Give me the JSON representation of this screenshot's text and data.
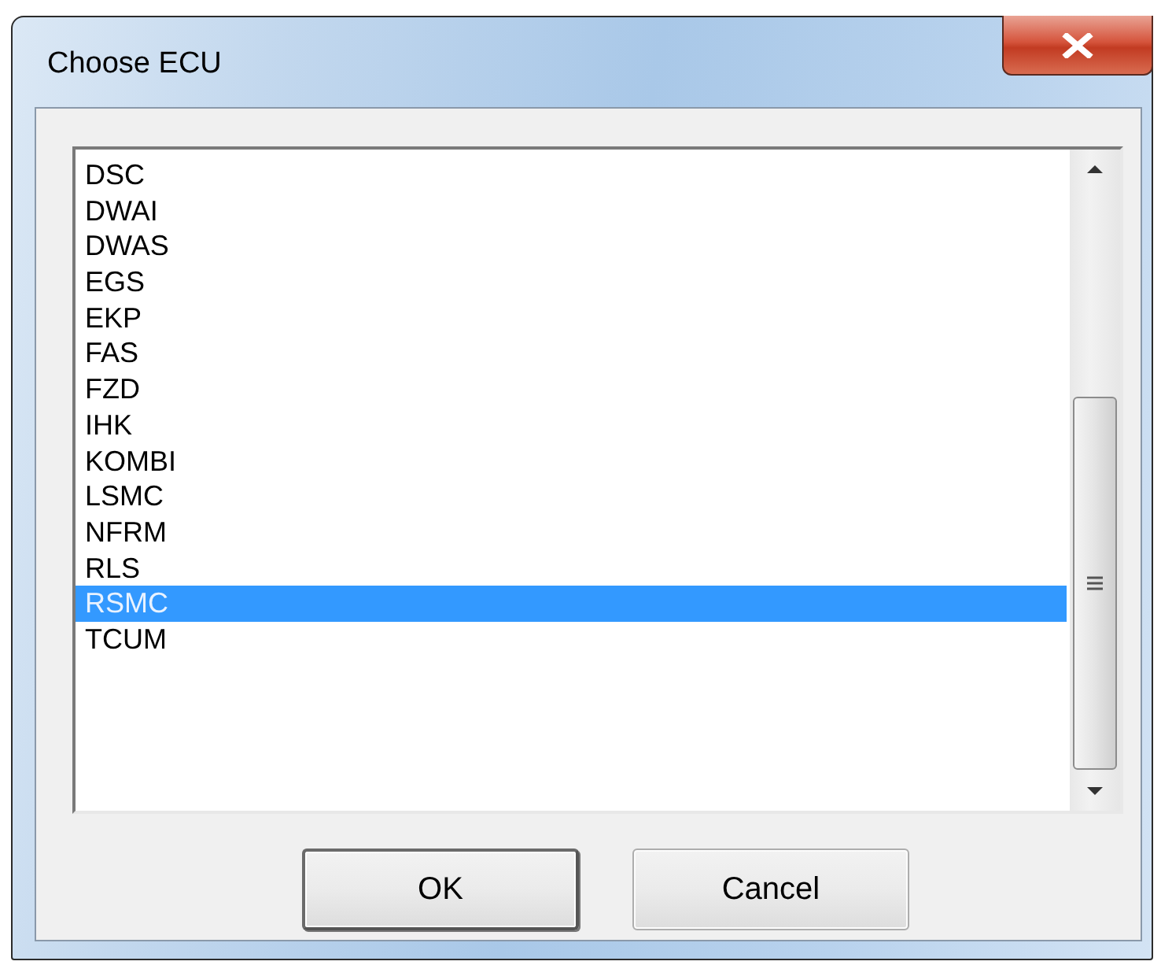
{
  "window": {
    "title": "Choose ECU"
  },
  "list": {
    "items": [
      {
        "label": "DSC",
        "selected": false
      },
      {
        "label": "DWAI",
        "selected": false
      },
      {
        "label": "DWAS",
        "selected": false
      },
      {
        "label": "EGS",
        "selected": false
      },
      {
        "label": "EKP",
        "selected": false
      },
      {
        "label": "FAS",
        "selected": false
      },
      {
        "label": "FZD",
        "selected": false
      },
      {
        "label": "IHK",
        "selected": false
      },
      {
        "label": "KOMBI",
        "selected": false
      },
      {
        "label": "LSMC",
        "selected": false
      },
      {
        "label": "NFRM",
        "selected": false
      },
      {
        "label": "RLS",
        "selected": false
      },
      {
        "label": "RSMC",
        "selected": true
      },
      {
        "label": "TCUM",
        "selected": false
      }
    ]
  },
  "buttons": [
    {
      "label": "OK",
      "default": true
    },
    {
      "label": "Cancel",
      "default": false
    }
  ]
}
